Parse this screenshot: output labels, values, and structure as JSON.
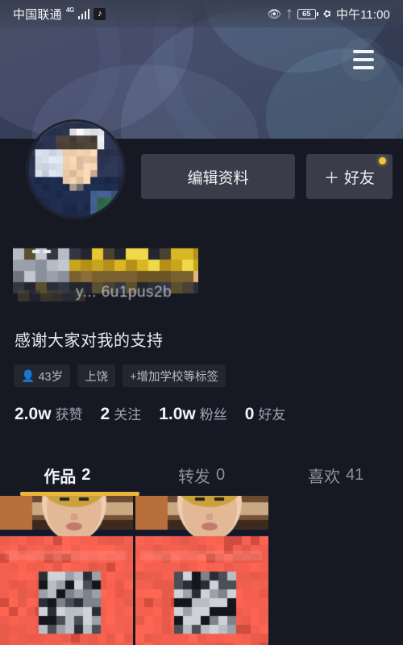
{
  "status_bar": {
    "carrier": "中国联通",
    "network_type": "4G",
    "app_badge_icon": "tiktok-note-icon",
    "signal_icon": "signal-bars-icon",
    "eye_icon": "eye-care-icon",
    "bluetooth_icon": "bluetooth-icon",
    "battery_level": "65",
    "battery_icon": "battery-icon",
    "power_save_icon": "leaf-power-save-icon",
    "time": "中午11:00"
  },
  "header": {
    "menu_icon": "hamburger-menu-icon",
    "banner_style": "abstract-dark-blue-gradient"
  },
  "profile": {
    "avatar_icon": "user-avatar-censored",
    "username_censored": true,
    "username_uid_fragment": "y... 6u1pus2b",
    "bio": "感谢大家对我的支持",
    "tags": [
      {
        "label": "43岁",
        "icon": "person-icon"
      },
      {
        "label": "上饶",
        "icon": ""
      },
      {
        "label": "+增加学校等标签",
        "icon": ""
      }
    ]
  },
  "actions": {
    "edit_profile_label": "编辑资料",
    "add_friend_plus": "＋",
    "add_friend_label": "好友",
    "badge_color": "#f2c438"
  },
  "stats": [
    {
      "num": "2.0w",
      "label": "获赞"
    },
    {
      "num": "2",
      "label": "关注"
    },
    {
      "num": "1.0w",
      "label": "粉丝"
    },
    {
      "num": "0",
      "label": "好友"
    }
  ],
  "tabs": [
    {
      "label": "作品",
      "count": "2",
      "active": true
    },
    {
      "label": "转发",
      "count": "0",
      "active": false
    },
    {
      "label": "喜欢",
      "count": "41",
      "active": false
    }
  ],
  "tab_indicator_color": "#e9b53c",
  "grid": {
    "items": [
      {
        "name": "video-thumbnail-1",
        "censored": true
      },
      {
        "name": "video-thumbnail-2",
        "censored": true
      }
    ]
  },
  "colors": {
    "page_background": "#161823",
    "banner_top": "#3d4357",
    "button_background": "#3a3d49",
    "accent_yellow": "#e9b53c",
    "tag_cyan": "#4fd2d8",
    "thumb_banner_red": "#f4604f"
  }
}
